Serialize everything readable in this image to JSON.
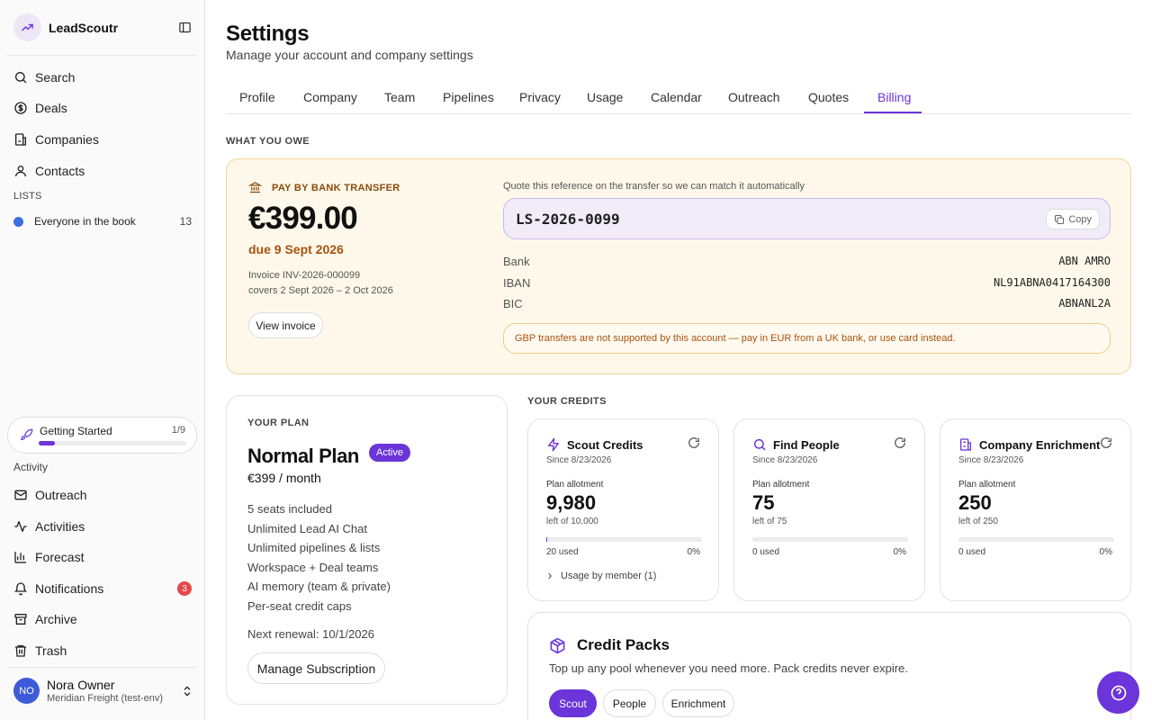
{
  "app": {
    "name": "LeadScoutr"
  },
  "sidebar": {
    "nav": [
      {
        "label": "Search",
        "icon": "search-icon"
      },
      {
        "label": "Deals",
        "icon": "dollar-icon"
      },
      {
        "label": "Companies",
        "icon": "building-icon"
      },
      {
        "label": "Contacts",
        "icon": "user-icon"
      }
    ],
    "lists_label": "LISTS",
    "lists": [
      {
        "label": "Everyone in the book",
        "count": "13",
        "color": "#3b6fe0"
      }
    ],
    "getting_started": {
      "label": "Getting Started",
      "count": "1/9",
      "progress": 0.11
    },
    "activity_label": "Activity",
    "activity": [
      {
        "label": "Outreach",
        "icon": "mail-icon"
      },
      {
        "label": "Activities",
        "icon": "activity-icon"
      },
      {
        "label": "Forecast",
        "icon": "chart-icon"
      },
      {
        "label": "Notifications",
        "icon": "bell-icon",
        "badge": "3"
      },
      {
        "label": "Archive",
        "icon": "archive-icon"
      },
      {
        "label": "Trash",
        "icon": "trash-icon"
      }
    ],
    "user": {
      "initials": "NO",
      "name": "Nora Owner",
      "org": "Meridian Freight (test-env)"
    }
  },
  "header": {
    "title": "Settings",
    "subtitle": "Manage your account and company settings"
  },
  "tabs": [
    "Profile",
    "Company",
    "Team",
    "Pipelines",
    "Privacy",
    "Usage",
    "Calendar",
    "Outreach",
    "Quotes",
    "Billing"
  ],
  "active_tab": "Billing",
  "owe": {
    "section_label": "WHAT YOU OWE",
    "pay_label": "PAY BY BANK TRANSFER",
    "amount": "€399.00",
    "due": "due 9 Sept 2026",
    "invoice": "Invoice INV-2026-000099",
    "covers": "covers 2 Sept 2026 – 2 Oct 2026",
    "view_invoice": "View invoice",
    "reference_hint": "Quote this reference on the transfer so we can match it automatically",
    "reference": "LS-2026-0099",
    "copy": "Copy",
    "bank_rows": [
      {
        "label": "Bank",
        "value": "ABN AMRO"
      },
      {
        "label": "IBAN",
        "value": "NL91ABNA0417164300"
      },
      {
        "label": "BIC",
        "value": "ABNANL2A"
      }
    ],
    "warning": "GBP transfers are not supported by this account — pay in EUR from a UK bank, or use card instead."
  },
  "plan": {
    "label": "YOUR PLAN",
    "name": "Normal Plan",
    "status": "Active",
    "price": "€399 / month",
    "features": [
      "5 seats included",
      "Unlimited Lead AI Chat",
      "Unlimited pipelines & lists",
      "Workspace + Deal teams",
      "AI memory (team & private)",
      "Per-seat credit caps"
    ],
    "renewal": "Next renewal: 10/1/2026",
    "manage": "Manage Subscription"
  },
  "credits": {
    "label": "YOUR CREDITS",
    "cards": [
      {
        "title": "Scout Credits",
        "icon": "lightning-icon",
        "since": "Since 8/23/2026",
        "allot_label": "Plan allotment",
        "value": "9,980",
        "left": "left of 10,000",
        "used": "20 used",
        "pct": "0%",
        "fill": 0.002,
        "member": "Usage by member (1)"
      },
      {
        "title": "Find People",
        "icon": "search-icon",
        "since": "Since 8/23/2026",
        "allot_label": "Plan allotment",
        "value": "75",
        "left": "left of 75",
        "used": "0 used",
        "pct": "0%",
        "fill": 0
      },
      {
        "title": "Company Enrichment",
        "icon": "building-icon",
        "since": "Since 8/23/2026",
        "allot_label": "Plan allotment",
        "value": "250",
        "left": "left of 250",
        "used": "0 used",
        "pct": "0%",
        "fill": 0
      }
    ]
  },
  "packs": {
    "title": "Credit Packs",
    "subtitle": "Top up any pool whenever you need more. Pack credits never expire.",
    "options": [
      "Scout",
      "People",
      "Enrichment"
    ],
    "selected": "Scout"
  },
  "colors": {
    "accent": "#6b35d9",
    "warning_bg": "#fef8ea",
    "warning_text": "#a8520d",
    "danger": "#e5484d"
  }
}
